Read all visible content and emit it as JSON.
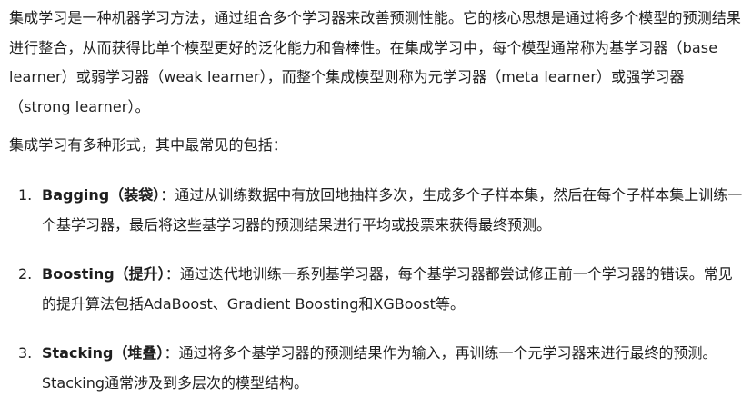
{
  "intro": "集成学习是一种机器学习方法，通过组合多个学习器来改善预测性能。它的核心思想是通过将多个模型的预测结果进行整合，从而获得比单个模型更好的泛化能力和鲁棒性。在集成学习中，每个模型通常称为基学习器（base learner）或弱学习器（weak learner），而整个集成模型则称为元学习器（meta learner）或强学习器（strong learner）。",
  "lead": "集成学习有多种形式，其中最常见的包括：",
  "items": [
    {
      "number": "1.",
      "term": "Bagging（装袋）",
      "text": "：通过从训练数据中有放回地抽样多次，生成多个子样本集，然后在每个子样本集上训练一个基学习器，最后将这些基学习器的预测结果进行平均或投票来获得最终预测。"
    },
    {
      "number": "2.",
      "term": "Boosting（提升）",
      "text": "：通过迭代地训练一系列基学习器，每个基学习器都尝试修正前一个学习器的错误。常见的提升算法包括AdaBoost、Gradient Boosting和XGBoost等。"
    },
    {
      "number": "3.",
      "term": "Stacking（堆叠）",
      "text": "：通过将多个基学习器的预测结果作为输入，再训练一个元学习器来进行最终的预测。Stacking通常涉及到多层次的模型结构。"
    }
  ]
}
